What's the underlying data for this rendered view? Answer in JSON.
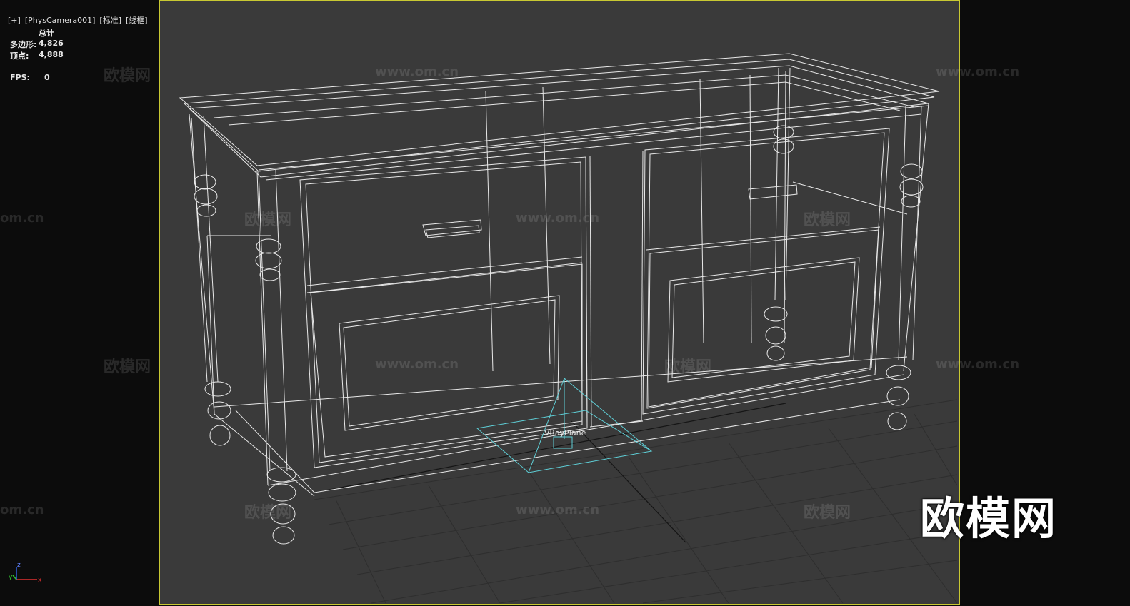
{
  "viewport": {
    "menu": "[+]",
    "camera": "[PhysCamera001]",
    "shading_mode": "[标准]",
    "display_mode": "[线框]"
  },
  "stats": {
    "header": "总计",
    "polygons_label": "多边形:",
    "polygons_value": "4,826",
    "vertices_label": "顶点:",
    "vertices_value": "4,888",
    "fps_label": "FPS:",
    "fps_value": "0"
  },
  "scene": {
    "object_label": "VRayPlane",
    "wireframe_color": "#e8e8e8",
    "light_color": "#5fd0d8",
    "frame_color": "#c8c832"
  },
  "axis_gizmo": {
    "x": "x",
    "y": "y",
    "z": "z"
  },
  "watermarks": {
    "brand": "欧模网",
    "url": "www.om.cn",
    "url_short": "om.cn"
  }
}
